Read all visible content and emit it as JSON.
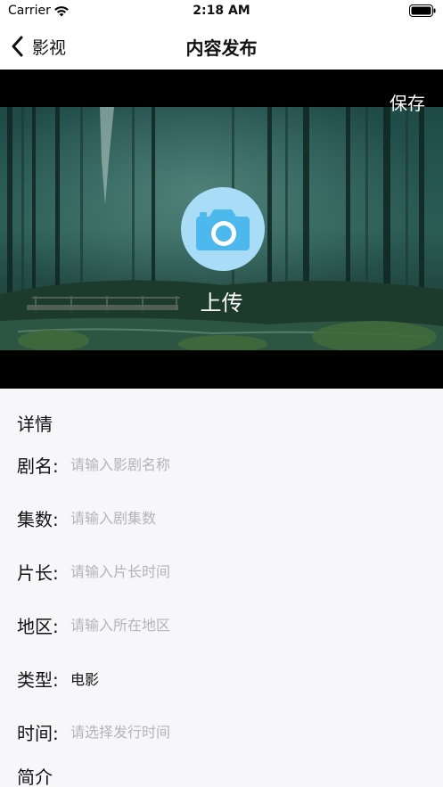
{
  "status_bar": {
    "carrier": "Carrier",
    "time": "2:18 AM"
  },
  "nav": {
    "back_label": "影视",
    "title": "内容发布"
  },
  "cover": {
    "save_label": "保存",
    "upload_label": "上传"
  },
  "form": {
    "details_title": "详情",
    "fields": [
      {
        "label": "剧名:",
        "placeholder": "请输入影剧名称"
      },
      {
        "label": "集数:",
        "placeholder": "请输入剧集数"
      },
      {
        "label": "片长:",
        "placeholder": "请输入片长时间"
      },
      {
        "label": "地区:",
        "placeholder": "请输入所在地区"
      },
      {
        "label": "类型:",
        "value": "电影"
      },
      {
        "label": "时间:",
        "placeholder": "请选择发行时间"
      }
    ],
    "intro_title": "简介"
  },
  "colors": {
    "camera_circle": "#a9dcf6",
    "camera_body": "#4db8ee"
  },
  "icons": [
    "wifi-icon",
    "battery-icon",
    "back-chevron-icon",
    "camera-icon"
  ]
}
